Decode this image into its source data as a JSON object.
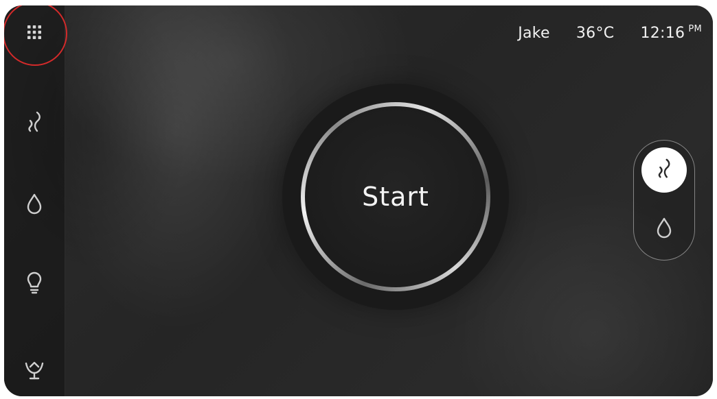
{
  "status_bar": {
    "user": "Jake",
    "temperature": "36°C",
    "time": "12:16",
    "ampm": "PM"
  },
  "sidebar": {
    "items": [
      {
        "icon": "grid-menu-icon",
        "highlighted": true
      },
      {
        "icon": "steam-icon"
      },
      {
        "icon": "water-drop-icon"
      },
      {
        "icon": "light-bulb-icon"
      },
      {
        "icon": "lotus-icon"
      }
    ]
  },
  "start_button": {
    "label": "Start"
  },
  "mode_toggle": {
    "options": [
      {
        "icon": "steam-icon",
        "selected": true
      },
      {
        "icon": "water-drop-icon",
        "selected": false
      }
    ]
  },
  "colors": {
    "highlight_ring": "#d42a2a",
    "text": "#f2f2f2",
    "icon": "#cfcfcf",
    "active_toggle_bg": "#ffffff",
    "active_toggle_icon": "#2a2a2a"
  }
}
